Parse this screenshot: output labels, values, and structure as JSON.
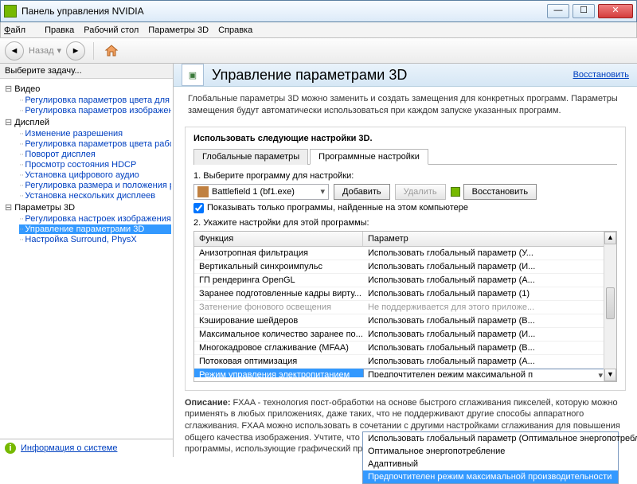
{
  "window": {
    "title": "Панель управления NVIDIA"
  },
  "menu": {
    "file": "Файл",
    "edit": "Правка",
    "desktop": "Рабочий стол",
    "params": "Параметры 3D",
    "help": "Справка"
  },
  "toolbar": {
    "back": "Назад"
  },
  "sidebar": {
    "header": "Выберите задачу...",
    "cats": [
      {
        "label": "Видео",
        "items": [
          "Регулировка параметров цвета для вид",
          "Регулировка параметров изображения д"
        ]
      },
      {
        "label": "Дисплей",
        "items": [
          "Изменение разрешения",
          "Регулировка параметров цвета рабочег",
          "Поворот дисплея",
          "Просмотр состояния HDCP",
          "Установка цифрового аудио",
          "Регулировка размера и положения рабо",
          "Установка нескольких дисплеев"
        ]
      },
      {
        "label": "Параметры 3D",
        "items": [
          "Регулировка настроек изображения с пр",
          "Управление параметрами 3D",
          "Настройка Surround, PhysX"
        ]
      }
    ],
    "selected": "Управление параметрами 3D",
    "sysinfo": "Информация о системе"
  },
  "main": {
    "title": "Управление параметрами 3D",
    "restore": "Восстановить",
    "desc": "Глобальные параметры 3D можно заменить и создать замещения для конкретных программ. Параметры замещения будут автоматически использоваться при каждом запуске указанных программ.",
    "boxlabel": "Использовать следующие настройки 3D.",
    "tabs": {
      "global": "Глобальные параметры",
      "program": "Программные настройки"
    },
    "step1": "1. Выберите программу для настройки:",
    "program": "Battlefield 1 (bf1.exe)",
    "add": "Добавить",
    "remove": "Удалить",
    "restore2": "Восстановить",
    "checkbox": "Показывать только программы, найденные на этом компьютере",
    "step2": "2. Укажите настройки для этой программы:",
    "gridhdr": {
      "c1": "Функция",
      "c2": "Параметр"
    },
    "rows": [
      {
        "f": "Анизотропная фильтрация",
        "p": "Использовать глобальный параметр (У..."
      },
      {
        "f": "Вертикальный синхроимпульс",
        "p": "Использовать глобальный параметр (И..."
      },
      {
        "f": "ГП рендеринга OpenGL",
        "p": "Использовать глобальный параметр (А..."
      },
      {
        "f": "Заранее подготовленные кадры вирту...",
        "p": "Использовать глобальный параметр (1)"
      },
      {
        "f": "Затенение фонового освещения",
        "p": "Не поддерживается для этого приложе...",
        "disabled": true
      },
      {
        "f": "Кэширование шейдеров",
        "p": "Использовать глобальный параметр (В..."
      },
      {
        "f": "Максимальное количество заранее по...",
        "p": "Использовать глобальный параметр (И..."
      },
      {
        "f": "Многокадровое сглаживание (MFAA)",
        "p": "Использовать глобальный параметр (В..."
      },
      {
        "f": "Потоковая оптимизация",
        "p": "Использовать глобальный параметр (А..."
      },
      {
        "f": "Режим управления электропитанием",
        "p": "Предпочтителен режим максимальной п",
        "sel": true
      }
    ],
    "dropdown": {
      "options": [
        "Использовать глобальный параметр (Оптимальное энергопотребление)",
        "Оптимальное энергопотребление",
        "Адаптивный",
        "Предпочтителен режим максимальной производительности"
      ],
      "selected": 3
    },
    "desc2title": "Описание:",
    "desc2": "FXAA - технология пост-обработки на основе быстрого сглаживания пикселей, которую можно применять в любых приложениях, даже таких, что не поддерживают другие способы аппаратного сглаживания. FXAA можно использовать в сочетании с другими настройками сглаживания для повышения общего качества изображения. Учтите, что глобальное включение этой настройки может повлиять на все программы, использующие графический процессор (ГП), включая видеоплееры и рабочий стол Windows."
  }
}
